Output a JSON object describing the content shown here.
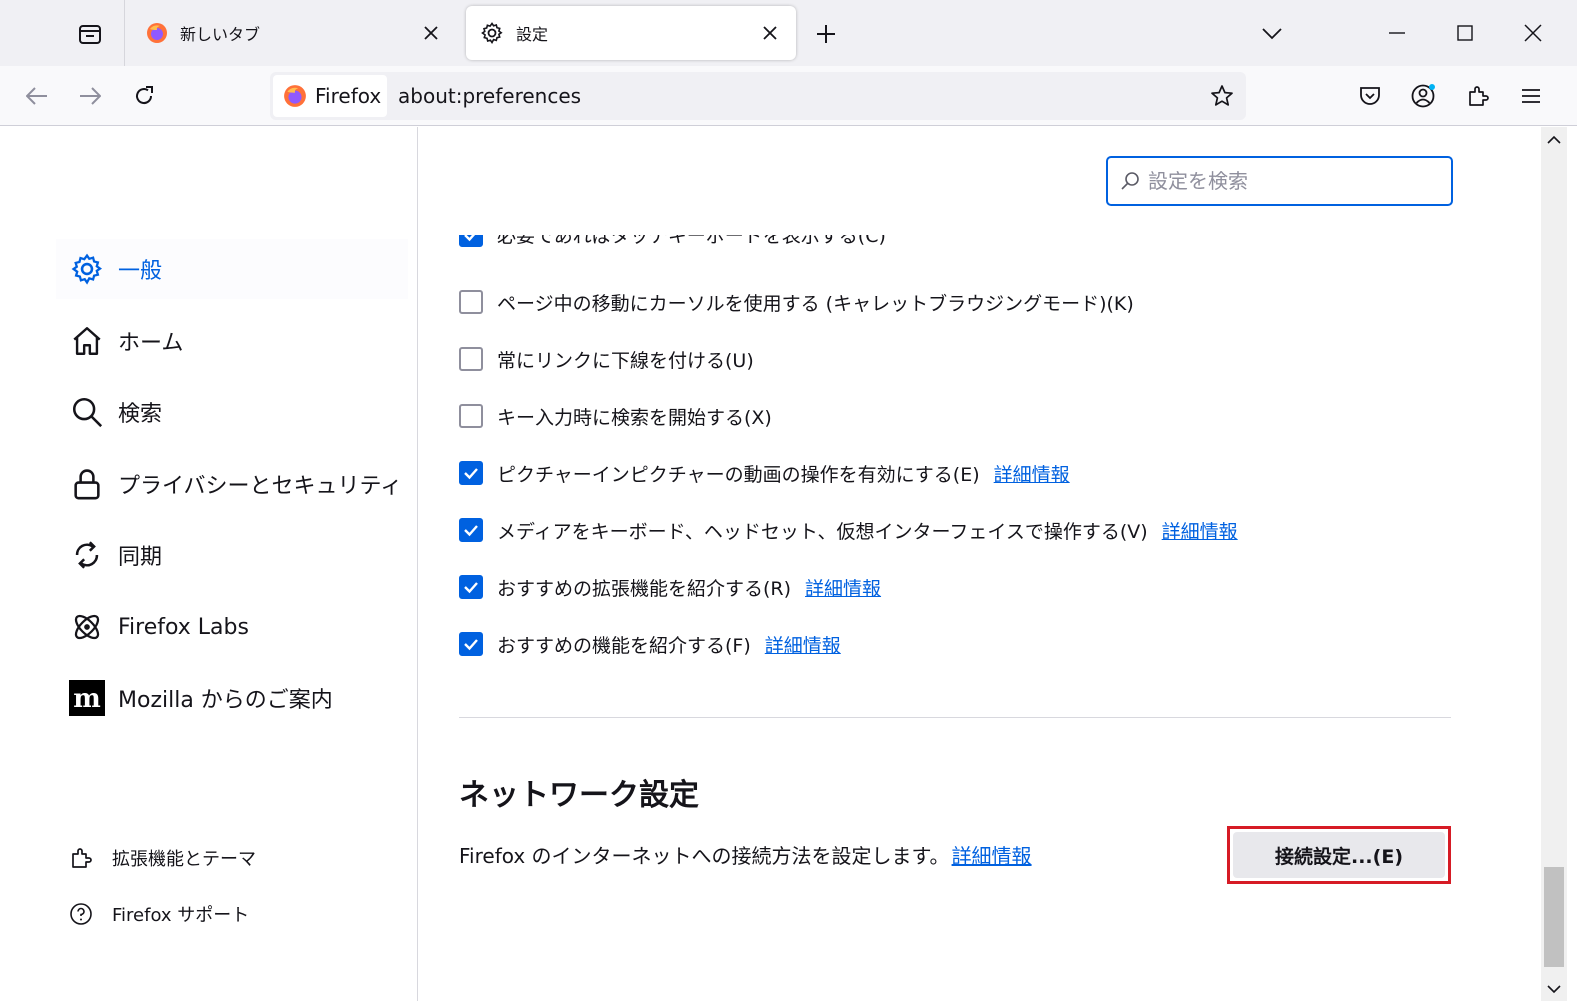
{
  "tabs": [
    {
      "title": "新しいタブ",
      "icon": "firefox-logo",
      "active": false
    },
    {
      "title": "設定",
      "icon": "gear-icon",
      "active": true
    }
  ],
  "navbar": {
    "identity_label": "Firefox",
    "url": "about:preferences"
  },
  "sidebar": {
    "categories": [
      {
        "label": "一般",
        "icon": "gear-icon",
        "selected": true
      },
      {
        "label": "ホーム",
        "icon": "home-icon",
        "selected": false
      },
      {
        "label": "検索",
        "icon": "search-icon",
        "selected": false
      },
      {
        "label": "プライバシーとセキュリティ",
        "icon": "lock-icon",
        "selected": false
      },
      {
        "label": "同期",
        "icon": "sync-icon",
        "selected": false
      },
      {
        "label": "Firefox Labs",
        "icon": "labs-icon",
        "selected": false
      },
      {
        "label": "Mozilla からのご案内",
        "icon": "mozilla-logo",
        "selected": false
      }
    ],
    "footer": [
      {
        "label": "拡張機能とテーマ",
        "icon": "puzzle-icon"
      },
      {
        "label": "Firefox サポート",
        "icon": "help-icon"
      }
    ]
  },
  "search": {
    "placeholder": "設定を検索"
  },
  "browsing_options": {
    "partial_label": "必要であればタッチキーボードを表示する(C)",
    "items": [
      {
        "label": "ページ中の移動にカーソルを使用する (キャレットブラウジングモード)(K)",
        "checked": false,
        "learn_more": ""
      },
      {
        "label": "常にリンクに下線を付ける(U)",
        "checked": false,
        "learn_more": ""
      },
      {
        "label": "キー入力時に検索を開始する(X)",
        "checked": false,
        "learn_more": ""
      },
      {
        "label": "ピクチャーインピクチャーの動画の操作を有効にする(E)",
        "checked": true,
        "learn_more": "詳細情報"
      },
      {
        "label": "メディアをキーボード、ヘッドセット、仮想インターフェイスで操作する(V)",
        "checked": true,
        "learn_more": "詳細情報"
      },
      {
        "label": "おすすめの拡張機能を紹介する(R)",
        "checked": true,
        "learn_more": "詳細情報"
      },
      {
        "label": "おすすめの機能を紹介する(F)",
        "checked": true,
        "learn_more": "詳細情報"
      }
    ]
  },
  "network": {
    "title": "ネットワーク設定",
    "description": "Firefox のインターネットへの接続方法を設定します。",
    "learn_more": "詳細情報",
    "button_label": "接続設定...(E)"
  },
  "colors": {
    "accent": "#0061e0",
    "highlight_border": "#d61b25"
  }
}
